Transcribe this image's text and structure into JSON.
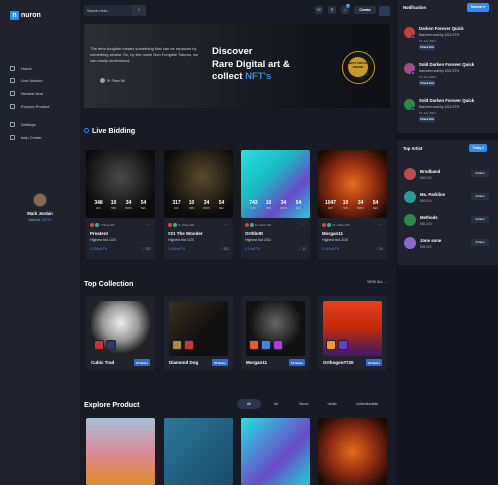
{
  "brand": {
    "logo_letter": "n",
    "name": "nuron"
  },
  "nav": {
    "items": [
      "Home",
      "Live Auction",
      "Newest Item",
      "Explore Product"
    ],
    "secondary": [
      "Settings",
      "help Center"
    ]
  },
  "profile": {
    "name": "Mark Jordan",
    "balance_label": "Balance",
    "balance_value": "12ETH"
  },
  "topbar": {
    "search_placeholder": "Search Here...",
    "search_icon": "⌕",
    "create_label": "Create",
    "notif_count": "6"
  },
  "hero": {
    "description": "The term fungible means something that can be replaced by something similar. So, by the name Non Fungible Tokens, we can easily understand.",
    "tag": "5+ Place Bit",
    "title_line1": "Discover",
    "title_line2": "Rare Digital art &",
    "title_plain": "collect ",
    "title_accent": "NFT's",
    "seal_text": "BEST ANUAL AWARD"
  },
  "live": {
    "title": "Live Bidding",
    "cards": [
      {
        "d": "348",
        "h": "10",
        "m": "34",
        "s": "54",
        "tag": "7 Place Bit",
        "title": "Preatent",
        "bid": "Highest bid 1/20",
        "price": "0.234wETH",
        "likes": "322"
      },
      {
        "d": "317",
        "h": "10",
        "m": "34",
        "s": "54",
        "tag": "5+ Place Bit",
        "title": "#21 The Wonder",
        "bid": "Highest bid 1/20",
        "price": "0.244wETH",
        "likes": "322"
      },
      {
        "d": "743",
        "h": "10",
        "m": "34",
        "s": "54",
        "tag": "8+ Place Bit",
        "title": "Orthbr8t",
        "bid": "Highest bid 2/31",
        "price": "0.11wETH",
        "likes": "12"
      },
      {
        "d": "1047",
        "h": "10",
        "m": "34",
        "s": "54",
        "tag": "15+ Place Bit",
        "title": "Morgan11",
        "bid": "Highest bid 3/16",
        "price": "0.244wETH",
        "likes": "20"
      }
    ],
    "labels": {
      "d": "DAY",
      "h": "HRS",
      "m": "MIN'S",
      "s": "SEC"
    }
  },
  "collection": {
    "title": "Top Collection",
    "view_all": "VIEW ALL →",
    "items": [
      {
        "name": "Cubic Trad",
        "count": "27 Items"
      },
      {
        "name": "Diamond Dog",
        "count": "20 Items"
      },
      {
        "name": "Morgan11",
        "count": "15 Items"
      },
      {
        "name": "Orthogon#720",
        "count": "10 Items"
      }
    ]
  },
  "explore": {
    "title": "Explore Product",
    "filters": [
      "All",
      "Art",
      "Music",
      "Vedio",
      "Collectionable"
    ]
  },
  "notifications": {
    "title": "Notification",
    "button": "Newest ▾",
    "items": [
      {
        "title": "Darken Forever Quick",
        "sub": "Has been sold by 1221 ETH",
        "date": "15 July 2021",
        "action": "Check Out"
      },
      {
        "title": "Sold Darken Forever Quick",
        "sub": "Has been sold by 1221 ETH",
        "date": "15 July 2021",
        "action": "Check Out"
      },
      {
        "title": "Sold Darken Forever Quick",
        "sub": "Has been sold by 1221 ETH",
        "date": "15 July 2021",
        "action": "Check Out"
      }
    ]
  },
  "top_artist": {
    "title": "Top Artist",
    "button": "Today ▾",
    "items": [
      {
        "name": "Brodband",
        "value": "$56,520",
        "action": "Follow"
      },
      {
        "name": "Ms. Parkline",
        "value": "$56,520",
        "action": "Follow"
      },
      {
        "name": "Methods",
        "value": "$56,520",
        "action": "Follow"
      },
      {
        "name": "Jone sone",
        "value": "$56,520",
        "action": "Follow"
      }
    ]
  }
}
